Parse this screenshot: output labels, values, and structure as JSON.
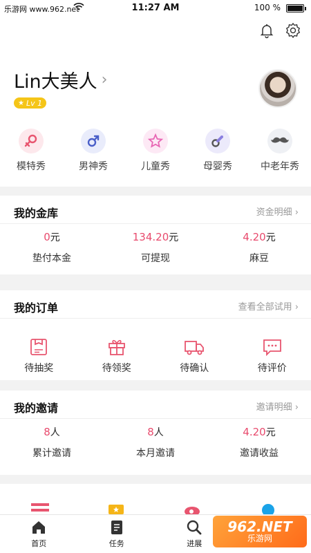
{
  "status_bar": {
    "carrier": "乐游网 www.962.net",
    "time": "11:27 AM",
    "battery": "100 %"
  },
  "header": {
    "icons": [
      "bell-icon",
      "gear-icon"
    ],
    "username": "Lin大美人",
    "level": "Lv 1"
  },
  "categories": [
    {
      "label": "模特秀",
      "icon": "female-icon",
      "color": "#e8556f"
    },
    {
      "label": "男神秀",
      "icon": "male-icon",
      "color": "#4a5fc8"
    },
    {
      "label": "儿童秀",
      "icon": "star-icon",
      "color": "#e866b4"
    },
    {
      "label": "母婴秀",
      "icon": "pacifier-icon",
      "color": "#8a7fe0"
    },
    {
      "label": "中老年秀",
      "icon": "mustache-icon",
      "color": "#555555"
    }
  ],
  "treasury": {
    "title": "我的金库",
    "link": "资金明细",
    "stats": [
      {
        "value": "0",
        "unit": "元",
        "label": "垫付本金"
      },
      {
        "value": "134.20",
        "unit": "元",
        "label": "可提现"
      },
      {
        "value": "4.20",
        "unit": "元",
        "label": "麻豆"
      }
    ]
  },
  "orders": {
    "title": "我的订单",
    "link": "查看全部试用",
    "items": [
      {
        "label": "待抽奖",
        "icon": "lottery-icon"
      },
      {
        "label": "待领奖",
        "icon": "gift-icon"
      },
      {
        "label": "待确认",
        "icon": "truck-icon"
      },
      {
        "label": "待评价",
        "icon": "comment-icon"
      }
    ]
  },
  "invites": {
    "title": "我的邀请",
    "link": "邀请明细",
    "stats": [
      {
        "value": "8",
        "unit": "人",
        "label": "累计邀请"
      },
      {
        "value": "8",
        "unit": "人",
        "label": "本月邀请"
      },
      {
        "value": "4.20",
        "unit": "元",
        "label": "邀请收益"
      }
    ]
  },
  "tabbar": [
    {
      "label": "首页",
      "icon": "home-icon"
    },
    {
      "label": "任务",
      "icon": "task-icon"
    },
    {
      "label": "进展",
      "icon": "search-icon"
    }
  ],
  "watermark": {
    "line1": "962.NET",
    "line2": "乐游网"
  },
  "colors": {
    "accent": "#e84a6d",
    "level_badge": "#f5c518"
  }
}
